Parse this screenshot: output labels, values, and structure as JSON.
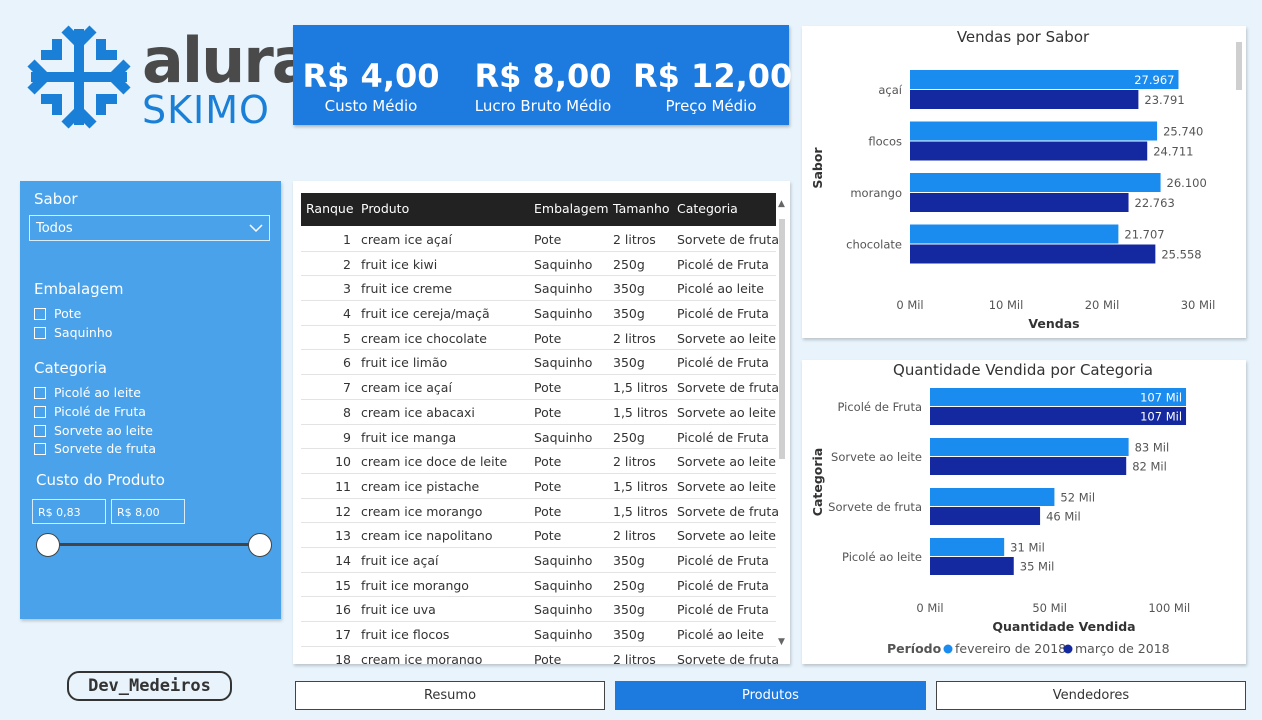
{
  "brand": {
    "word": "alura",
    "sub": "SKIMO",
    "primary_color": "#1a7fd6"
  },
  "kpis": [
    {
      "value": "R$ 4,00",
      "label": "Custo Médio"
    },
    {
      "value": "R$ 8,00",
      "label": "Lucro Bruto Médio"
    },
    {
      "value": "R$ 12,00",
      "label": "Preço Médio"
    }
  ],
  "filters": {
    "sabor": {
      "title": "Sabor",
      "selected": "Todos"
    },
    "embalagem": {
      "title": "Embalagem",
      "options": [
        "Pote",
        "Saquinho"
      ]
    },
    "categoria": {
      "title": "Categoria",
      "options": [
        "Picolé ao leite",
        "Picolé de Fruta",
        "Sorvete ao leite",
        "Sorvete de fruta"
      ]
    },
    "custo": {
      "title": "Custo do Produto",
      "min": "R$ 0,83",
      "max": "R$ 8,00"
    }
  },
  "dev_badge": "Dev_Medeiros",
  "table": {
    "headers": [
      "Ranque",
      "Produto",
      "Embalagem",
      "Tamanho",
      "Categoria"
    ],
    "rows": [
      [
        "1",
        "cream ice açaí",
        "Pote",
        "2 litros",
        "Sorvete de fruta"
      ],
      [
        "2",
        "fruit ice kiwi",
        "Saquinho",
        "250g",
        "Picolé de Fruta"
      ],
      [
        "3",
        "fruit ice creme",
        "Saquinho",
        "350g",
        "Picolé ao leite"
      ],
      [
        "4",
        "fruit ice cereja/maçã",
        "Saquinho",
        "350g",
        "Picolé de Fruta"
      ],
      [
        "5",
        "cream ice chocolate",
        "Pote",
        "2 litros",
        "Sorvete ao leite"
      ],
      [
        "6",
        "fruit ice limão",
        "Saquinho",
        "350g",
        "Picolé de Fruta"
      ],
      [
        "7",
        "cream ice açaí",
        "Pote",
        "1,5 litros",
        "Sorvete de fruta"
      ],
      [
        "8",
        "cream ice abacaxi",
        "Pote",
        "1,5 litros",
        "Sorvete ao leite"
      ],
      [
        "9",
        "fruit ice manga",
        "Saquinho",
        "250g",
        "Picolé de Fruta"
      ],
      [
        "10",
        "cream ice doce de leite",
        "Pote",
        "2 litros",
        "Sorvete ao leite"
      ],
      [
        "11",
        "cream ice pistache",
        "Pote",
        "1,5 litros",
        "Sorvete ao leite"
      ],
      [
        "12",
        "cream ice morango",
        "Pote",
        "1,5 litros",
        "Sorvete de fruta"
      ],
      [
        "13",
        "cream ice napolitano",
        "Pote",
        "2 litros",
        "Sorvete ao leite"
      ],
      [
        "14",
        "fruit ice açaí",
        "Saquinho",
        "350g",
        "Picolé de Fruta"
      ],
      [
        "15",
        "fruit ice morango",
        "Saquinho",
        "250g",
        "Picolé de Fruta"
      ],
      [
        "16",
        "fruit ice uva",
        "Saquinho",
        "350g",
        "Picolé de Fruta"
      ],
      [
        "17",
        "fruit ice flocos",
        "Saquinho",
        "350g",
        "Picolé ao leite"
      ],
      [
        "18",
        "cream ice morango",
        "Pote",
        "2 litros",
        "Sorvete de fruta"
      ]
    ]
  },
  "tabs": [
    {
      "label": "Resumo",
      "active": false
    },
    {
      "label": "Produtos",
      "active": true
    },
    {
      "label": "Vendedores",
      "active": false
    }
  ],
  "chart_data": [
    {
      "type": "bar",
      "orientation": "horizontal",
      "title": "Vendas por Sabor",
      "xlabel": "Vendas",
      "ylabel": "Sabor",
      "categories": [
        "açaí",
        "flocos",
        "morango",
        "chocolate"
      ],
      "series": [
        {
          "values": [
            27967,
            25740,
            26100,
            21707
          ],
          "labels": [
            "27.967",
            "25.740",
            "26.100",
            "21.707"
          ],
          "color": "#1a8cf0"
        },
        {
          "values": [
            23791,
            24711,
            22763,
            25558
          ],
          "labels": [
            "23.791",
            "24.711",
            "22.763",
            "25.558"
          ],
          "color": "#1429a0"
        }
      ],
      "xlim": [
        0,
        30000
      ],
      "xticks": [
        0,
        10000,
        20000,
        30000
      ],
      "xtick_labels": [
        "0 Mil",
        "10 Mil",
        "20 Mil",
        "30 Mil"
      ],
      "grid": false
    },
    {
      "type": "bar",
      "orientation": "horizontal",
      "title": "Quantidade Vendida por Categoria",
      "xlabel": "Quantidade Vendida",
      "ylabel": "Categoria",
      "categories": [
        "Picolé de Fruta",
        "Sorvete ao leite",
        "Sorvete de fruta",
        "Picolé ao leite"
      ],
      "series": [
        {
          "name": "fevereiro de 2018",
          "values": [
            107000,
            83000,
            52000,
            31000
          ],
          "labels": [
            "107 Mil",
            "83 Mil",
            "52 Mil",
            "31 Mil"
          ],
          "color": "#1a8cf0"
        },
        {
          "name": "março de 2018",
          "values": [
            107000,
            82000,
            46000,
            35000
          ],
          "labels": [
            "107 Mil",
            "82 Mil",
            "46 Mil",
            "35 Mil"
          ],
          "color": "#1429a0"
        }
      ],
      "legend_title": "Período",
      "legend_position": "bottom",
      "xlim": [
        0,
        112000
      ],
      "xticks": [
        0,
        50000,
        100000
      ],
      "xtick_labels": [
        "0 Mil",
        "50 Mil",
        "100 Mil"
      ],
      "grid": false
    }
  ]
}
